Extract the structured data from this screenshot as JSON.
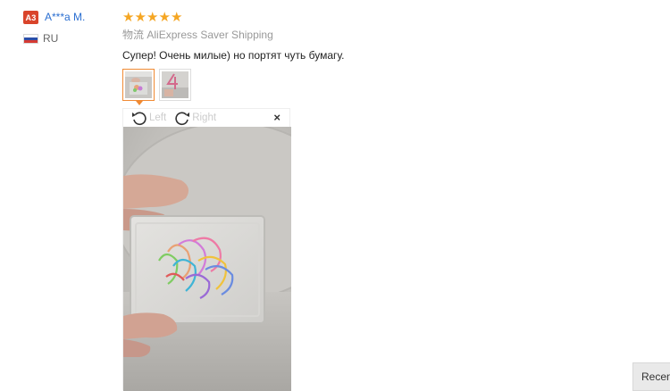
{
  "reviewer": {
    "avatar_initials": "A3",
    "avatar_color": "#d9442b",
    "name": "A***a M.",
    "country_code": "RU",
    "flag_icon": "russia-flag-icon"
  },
  "review": {
    "rating_stars": 5,
    "rating_max": 5,
    "star_glyph": "★",
    "star_color": "#f5a623",
    "shipping_chinese": "物流",
    "shipping_method": "AliExpress Saver Shipping",
    "text": "Супер! Очень милые) но портят чуть бумагу."
  },
  "thumbnails": [
    {
      "icon": "review-photo-paperclips",
      "selected": true
    },
    {
      "icon": "review-photo-number-4",
      "selected": false
    }
  ],
  "viewer": {
    "rotate_left_label": "Left",
    "rotate_right_label": "Right",
    "close_glyph": "×"
  },
  "recent_button": {
    "label": "Recent"
  },
  "colors": {
    "link": "#2b6fd1",
    "accent_orange": "#f08a33",
    "muted_text": "#999999"
  }
}
